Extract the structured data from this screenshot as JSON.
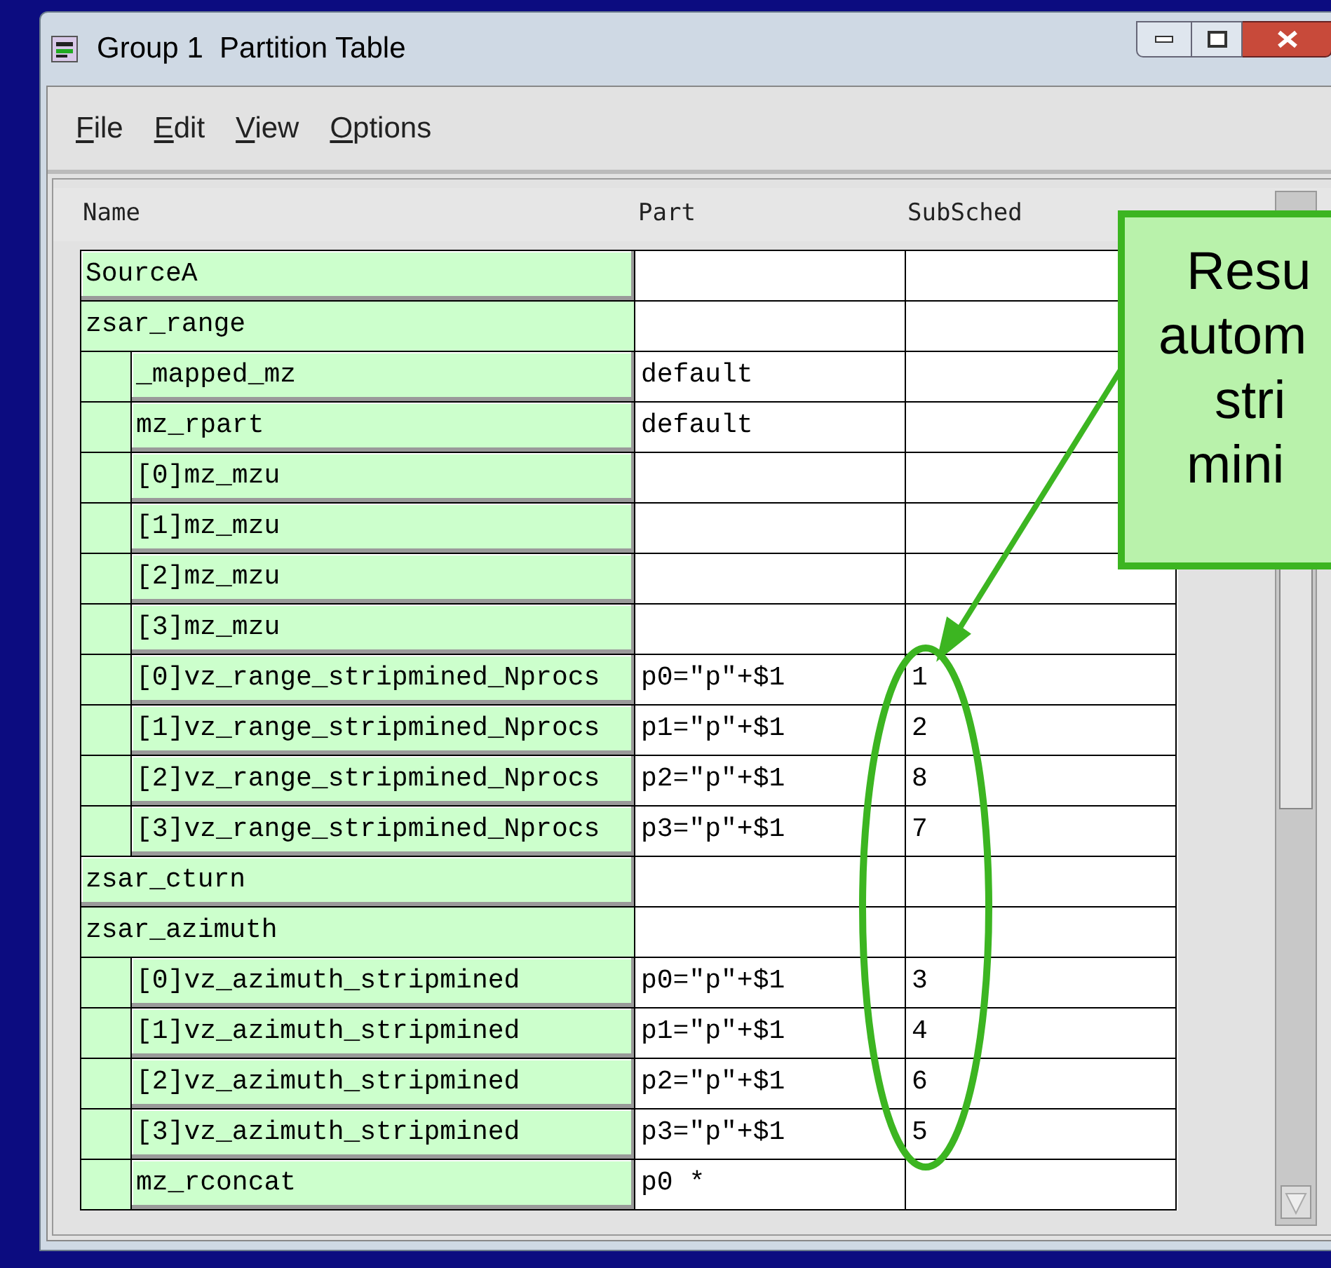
{
  "window": {
    "title": "Group 1  Partition Table"
  },
  "menu": [
    "File",
    "Edit",
    "View",
    "Options"
  ],
  "table": {
    "columns": [
      "Name",
      "Part",
      "SubSched"
    ],
    "rows": [
      {
        "name": "SourceA"
      },
      {
        "name": "zsar_range",
        "children": [
          {
            "name": "_mapped_mz",
            "part": "default"
          },
          {
            "name": "mz_rpart",
            "part": "default"
          },
          {
            "name": "[0]mz_mzu"
          },
          {
            "name": "[1]mz_mzu"
          },
          {
            "name": "[2]mz_mzu"
          },
          {
            "name": "[3]mz_mzu"
          },
          {
            "name": "[0]vz_range_stripmined_Nprocs",
            "part": "p0=\"p\"+$1",
            "subsched": "1"
          },
          {
            "name": "[1]vz_range_stripmined_Nprocs",
            "part": "p1=\"p\"+$1",
            "subsched": "2"
          },
          {
            "name": "[2]vz_range_stripmined_Nprocs",
            "part": "p2=\"p\"+$1",
            "subsched": "8"
          },
          {
            "name": "[3]vz_range_stripmined_Nprocs",
            "part": "p3=\"p\"+$1",
            "subsched": "7"
          }
        ]
      },
      {
        "name": "zsar_cturn"
      },
      {
        "name": "zsar_azimuth",
        "children": [
          {
            "name": "[0]vz_azimuth_stripmined",
            "part": "p0=\"p\"+$1",
            "subsched": "3"
          },
          {
            "name": "[1]vz_azimuth_stripmined",
            "part": "p1=\"p\"+$1",
            "subsched": "4"
          },
          {
            "name": "[2]vz_azimuth_stripmined",
            "part": "p2=\"p\"+$1",
            "subsched": "6"
          },
          {
            "name": "[3]vz_azimuth_stripmined",
            "part": "p3=\"p\"+$1",
            "subsched": "5"
          },
          {
            "name": "mz_rconcat",
            "part": "p0 *"
          }
        ]
      }
    ]
  },
  "callout": {
    "lines": [
      "Resu",
      "autom",
      "stri",
      "mini"
    ]
  }
}
